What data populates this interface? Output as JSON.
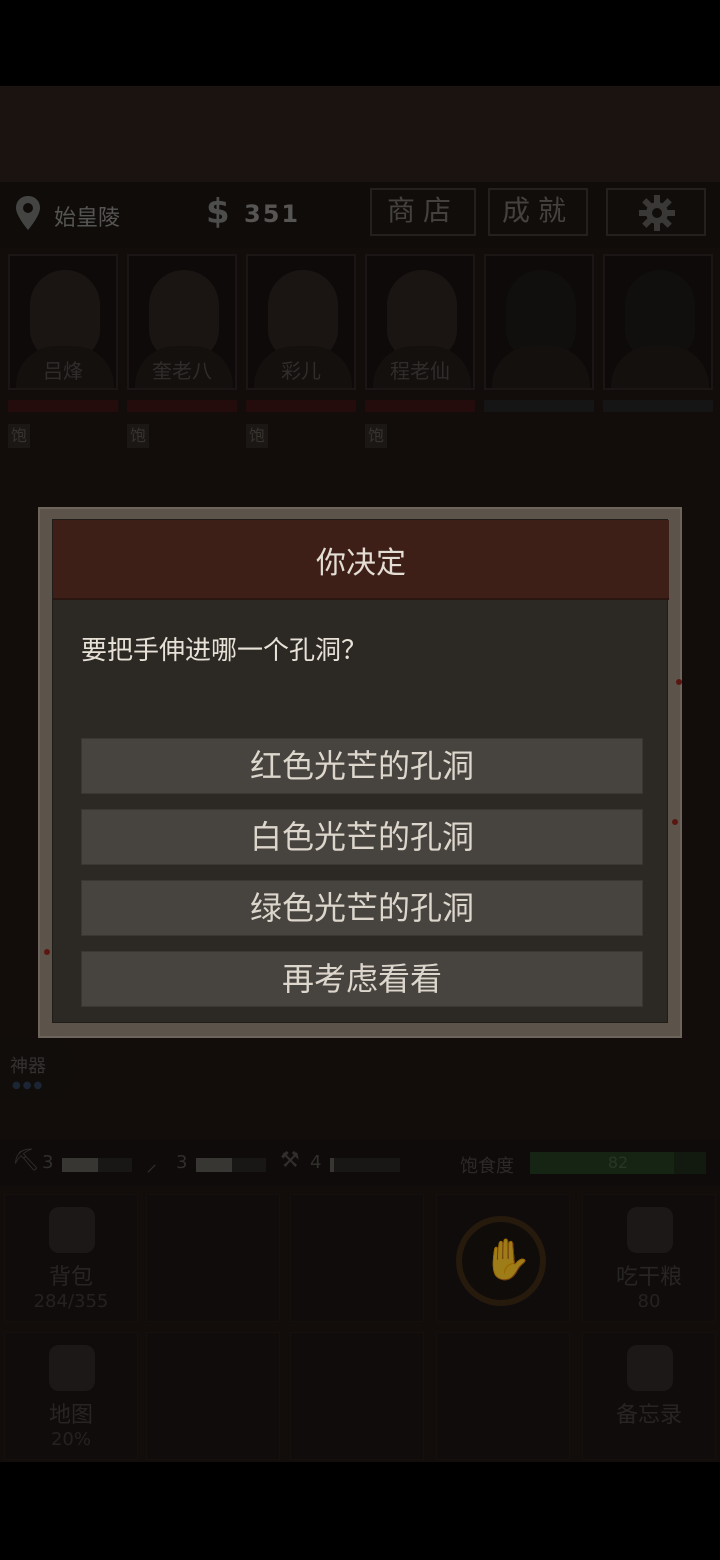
{
  "status": {
    "location": "始皇陵",
    "money_symbol": "$",
    "money": "351",
    "shop_label": "商店",
    "achievements_label": "成就"
  },
  "party": [
    {
      "name": "吕烽",
      "status": "饱",
      "empty": false
    },
    {
      "name": "奎老八",
      "status": "饱",
      "empty": false
    },
    {
      "name": "彩儿",
      "status": "饱",
      "empty": false
    },
    {
      "name": "程老仙",
      "status": "饱",
      "empty": false
    },
    {
      "name": "",
      "status": "",
      "empty": true
    },
    {
      "name": "",
      "status": "",
      "empty": true
    }
  ],
  "artifact": {
    "label": "神器"
  },
  "tools": [
    {
      "icon": "axe-icon",
      "glyph": "⛏",
      "count": "3"
    },
    {
      "icon": "pickaxe-icon",
      "glyph": "⸝",
      "count": "3"
    },
    {
      "icon": "shovel-icon",
      "glyph": "⚒",
      "count": "4"
    }
  ],
  "satiety": {
    "label": "饱食度",
    "value": "82",
    "percent": 82
  },
  "grid": {
    "backpack": {
      "label": "背包",
      "sub": "284/355"
    },
    "eat": {
      "label": "吃干粮",
      "sub": "80"
    },
    "map": {
      "label": "地图",
      "sub": "20%"
    },
    "memo": {
      "label": "备忘录"
    }
  },
  "dialog": {
    "title": "你决定",
    "question": "要把手伸进哪一个孔洞？",
    "options": [
      "红色光芒的孔洞",
      "白色光芒的孔洞",
      "绿色光芒的孔洞",
      "再考虑看看"
    ]
  },
  "colors": {
    "header_red": "#3d1f18",
    "option_bg": "#47433e",
    "frame": "#5c544b"
  }
}
